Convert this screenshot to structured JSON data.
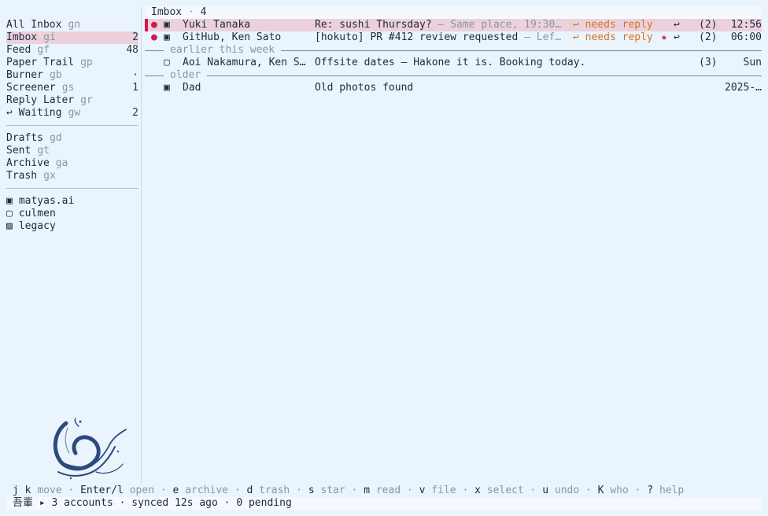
{
  "sidebar": {
    "mailboxes": [
      {
        "label": "All Inbox",
        "key": "gn",
        "count": ""
      },
      {
        "label": "Imbox",
        "key": "gi",
        "count": "2"
      },
      {
        "label": "Feed",
        "key": "gf",
        "count": "48"
      },
      {
        "label": "Paper Trail",
        "key": "gp",
        "count": ""
      },
      {
        "label": "Burner",
        "key": "gb",
        "count": "·"
      },
      {
        "label": "Screener",
        "key": "gs",
        "count": "1"
      },
      {
        "label": "Reply Later",
        "key": "gr",
        "count": ""
      },
      {
        "label": "↩ Waiting",
        "key": "gw",
        "count": "2"
      }
    ],
    "folders": [
      {
        "label": "Drafts",
        "key": "gd"
      },
      {
        "label": "Sent",
        "key": "gt"
      },
      {
        "label": "Archive",
        "key": "ga"
      },
      {
        "label": "Trash",
        "key": "gx"
      }
    ],
    "accounts": [
      {
        "icon": "▣",
        "label": "matyas.ai"
      },
      {
        "icon": "▢",
        "label": "culmen"
      },
      {
        "icon": "▨",
        "label": "legacy"
      }
    ]
  },
  "header": {
    "title": "Imbox",
    "sep": " · ",
    "count": "4"
  },
  "messages_top": [
    {
      "unread": "●",
      "acct": "▣",
      "from": "Yuki Tanaka",
      "subject": "Re: sushi Thursday?",
      "snippet": " — Same place, 19:30…",
      "tag": "↩ needs reply",
      "star": "",
      "reply": "↩",
      "count": "(2)",
      "time": "12:56"
    },
    {
      "unread": "●",
      "acct": "▣",
      "from": "GitHub, Ken Sato",
      "subject": "[hokuto] PR #412 review requested",
      "snippet": " — Lef…",
      "tag": "↩ needs reply",
      "star": "★",
      "reply": "↩",
      "count": "(2)",
      "time": "06:00"
    }
  ],
  "sections": {
    "earlier": {
      "title": "earlier this week"
    },
    "older": {
      "title": "older"
    }
  },
  "message_earlier": {
    "unread": "",
    "acct": "▢",
    "from": "Aoi Nakamura, Ken S…",
    "subject": "Offsite dates",
    "snippet": " — Hakone it is. Booking today.",
    "count": "(3)",
    "time": "Sun"
  },
  "message_older": {
    "unread": "",
    "acct": "▣",
    "from": "Dad",
    "subject": "Old photos found",
    "snippet": "",
    "count": "",
    "time": "2025-…"
  },
  "keybar": [
    {
      "k": "j k",
      "a": "move"
    },
    {
      "k": "Enter/l",
      "a": "open"
    },
    {
      "k": "e",
      "a": "archive"
    },
    {
      "k": "d",
      "a": "trash"
    },
    {
      "k": "s",
      "a": "star"
    },
    {
      "k": "m",
      "a": "read"
    },
    {
      "k": "v",
      "a": "file"
    },
    {
      "k": "x",
      "a": "select"
    },
    {
      "k": "u",
      "a": "undo"
    },
    {
      "k": "K",
      "a": "who"
    },
    {
      "k": "?",
      "a": "help"
    }
  ],
  "keybar_sep": " · ",
  "status": {
    "name": "吾輩",
    "arrow": "▸",
    "accounts": "3 accounts",
    "sep": " · ",
    "synced": "synced 12s ago",
    "pending": "0 pending"
  },
  "colors": {
    "background": "#eaf4fc",
    "selection": "#ecd1dd",
    "accent": "#d11a4a",
    "tag": "#d7731f",
    "muted": "#8a96a3",
    "logo": "#2c4a80"
  },
  "icons": {
    "logo": "ink-brush-logo"
  }
}
